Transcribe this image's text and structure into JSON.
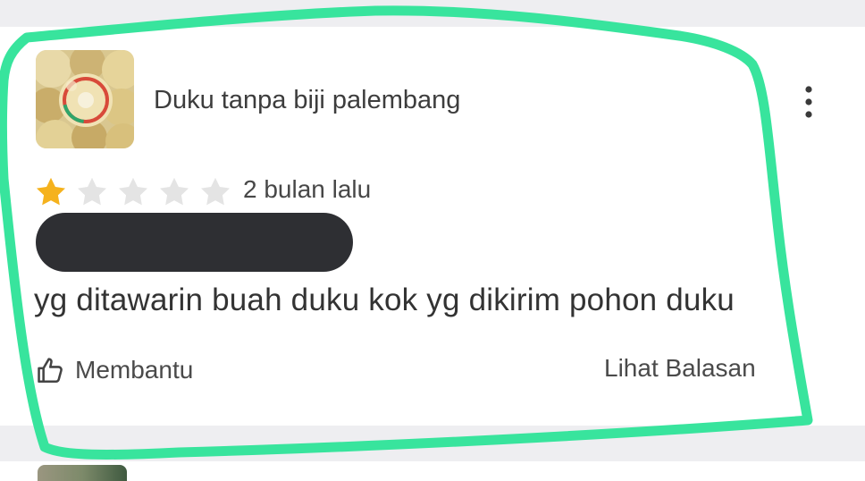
{
  "review": {
    "product_name": "Duku tanpa biji palembang",
    "rating": 1,
    "max_rating": 5,
    "time_ago": "2 bulan lalu",
    "text": "yg ditawarin buah duku kok yg dikirim pohon duku",
    "helpful_label": "Membantu",
    "replies_label": "Lihat Balasan"
  },
  "icons": {
    "more": "more-vertical-icon",
    "helpful": "thumbs-up-icon",
    "star": "star-icon"
  },
  "colors": {
    "star_filled": "#F5B21D",
    "star_empty": "#E4E4E4",
    "highlight": "#38E49D",
    "redaction": "#2E2F33",
    "page_gap": "#EEEEF1"
  }
}
